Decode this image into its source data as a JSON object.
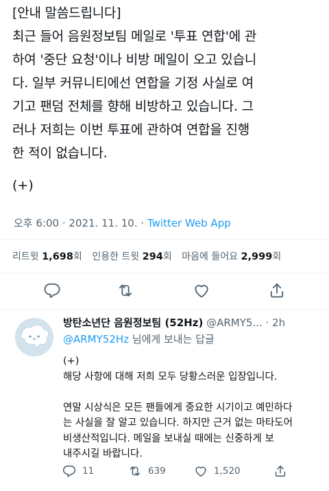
{
  "tweet": {
    "lines": [
      "[안내 말씀드립니다]",
      "최근 들어 음원정보팀 메일로 '투표 연합'에 관",
      "하여 '중단 요청'이나 비방 메일이 오고 있습니",
      "다. 일부 커뮤니티에선 연합을 기정 사실로 여",
      "기고 팬덤 전체를 향해 비방하고 있습니다. 그",
      "러나 저희는 이번 투표에 관하여 연합을 진행",
      "한 적이 없습니다."
    ],
    "plus": "(+)",
    "time": "오후 6:00",
    "dot": "·",
    "date": "2021. 11. 10.",
    "app": "Twitter Web App",
    "stats": {
      "retweets_label": "리트윗",
      "retweets": "1,698",
      "retweets_unit": "회",
      "quotes_label": "인용한 트윗",
      "quotes": "294",
      "quotes_unit": "회",
      "likes_label": "마음에 들어요",
      "likes": "2,999",
      "likes_unit": "회"
    },
    "icons": [
      "reply-icon",
      "retweet-icon",
      "like-icon",
      "share-icon"
    ]
  },
  "reply": {
    "name": "방탄소년단 음원정보팀 (52Hz)",
    "handle": "@ARMY5...",
    "dot": "·",
    "time": "2h",
    "to_mention": "@ARMY52Hz",
    "to_suffix": "님에게 보내는 답글",
    "lines": [
      "(+)",
      "해당 사항에 대해 저희 모두 당황스러운 입장입니다.",
      "",
      "연말 시상식은 모든 팬들에게 중요한 시기이고 예민하다",
      "는 사실을 잘 알고 있습니다. 하지만 근거 없는 마타도어",
      "비생산적입니다. 메일을 보내실 때에는 신중하게 보",
      "내주시길 바랍니다."
    ],
    "counts": {
      "replies": "11",
      "retweets": "639",
      "likes": "1,520"
    }
  },
  "colors": {
    "accent": "#1d9bf0",
    "text": "#0f1419",
    "muted": "#536471",
    "divider": "#eff3f4"
  }
}
